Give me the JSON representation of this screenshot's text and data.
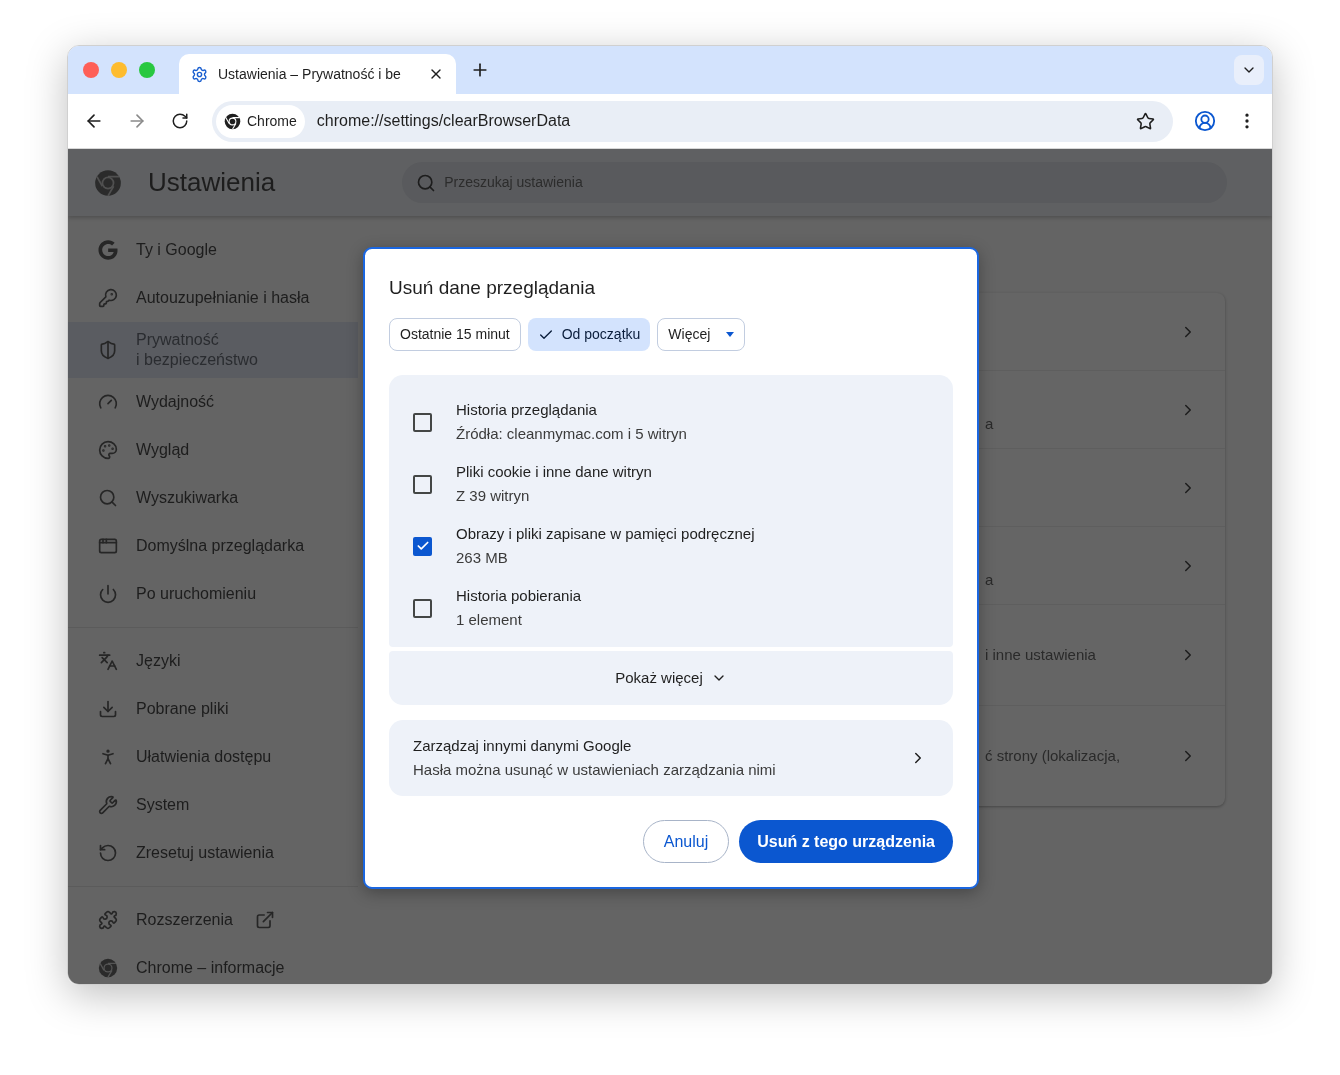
{
  "window": {
    "tab_title": "Ustawienia – Prywatność i be",
    "address_chip": "Chrome",
    "url": "chrome://settings/clearBrowserData"
  },
  "settings": {
    "title": "Ustawienia",
    "search_placeholder": "Przeszukaj ustawienia"
  },
  "sidebar": {
    "groups": [
      [
        {
          "label": "Ty i Google",
          "selected": false
        },
        {
          "label": "Autouzupełnianie i hasła",
          "selected": false
        },
        {
          "label": "Prywatność\ni bezpieczeństwo",
          "selected": true
        },
        {
          "label": "Wydajność",
          "selected": false
        },
        {
          "label": "Wygląd",
          "selected": false
        },
        {
          "label": "Wyszukiwarka",
          "selected": false
        },
        {
          "label": "Domyślna przeglądarka",
          "selected": false
        },
        {
          "label": "Po uruchomieniu",
          "selected": false
        }
      ],
      [
        {
          "label": "Języki",
          "selected": false
        },
        {
          "label": "Pobrane pliki",
          "selected": false
        },
        {
          "label": "Ułatwienia dostępu",
          "selected": false
        },
        {
          "label": "System",
          "selected": false
        },
        {
          "label": "Zresetuj ustawienia",
          "selected": false
        }
      ],
      [
        {
          "label": "Rozszerzenia",
          "selected": false,
          "external": true
        },
        {
          "label": "Chrome – informacje",
          "selected": false,
          "external": false
        }
      ]
    ]
  },
  "card": {
    "rows": [
      {
        "kind": "plain"
      },
      {
        "kind": "low",
        "text": "a"
      },
      {
        "kind": "plain"
      },
      {
        "kind": "low",
        "text": "a"
      },
      {
        "kind": "mid",
        "text": "i inne ustawienia"
      },
      {
        "kind": "mid",
        "text": "ć strony (lokalizacja,"
      }
    ]
  },
  "dialog": {
    "title": "Usuń dane przeglądania",
    "chips": [
      {
        "kind": "chip",
        "label": "Ostatnie 15 minut",
        "selected": false
      },
      {
        "kind": "chip",
        "label": "Od początku",
        "selected": true
      },
      {
        "kind": "dropdown",
        "label": "Więcej",
        "selected": false
      }
    ],
    "items": [
      {
        "title": "Historia przeglądania",
        "subtitle": "Źródła: cleanmymac.com i 5 witryn",
        "checked": false
      },
      {
        "title": "Pliki cookie i inne dane witryn",
        "subtitle": "Z 39 witryn",
        "checked": false
      },
      {
        "title": "Obrazy i pliki zapisane w pamięci podręcznej",
        "subtitle": "263 MB",
        "checked": true
      },
      {
        "title": "Historia pobierania",
        "subtitle": "1 element",
        "checked": false
      }
    ],
    "show_more": "Pokaż więcej",
    "manage": {
      "title": "Zarządzaj innymi danymi Google",
      "subtitle": "Hasła można usunąć w ustawieniach zarządzania nimi"
    },
    "buttons": {
      "cancel": "Anuluj",
      "confirm": "Usuń z tego urządzenia"
    }
  }
}
